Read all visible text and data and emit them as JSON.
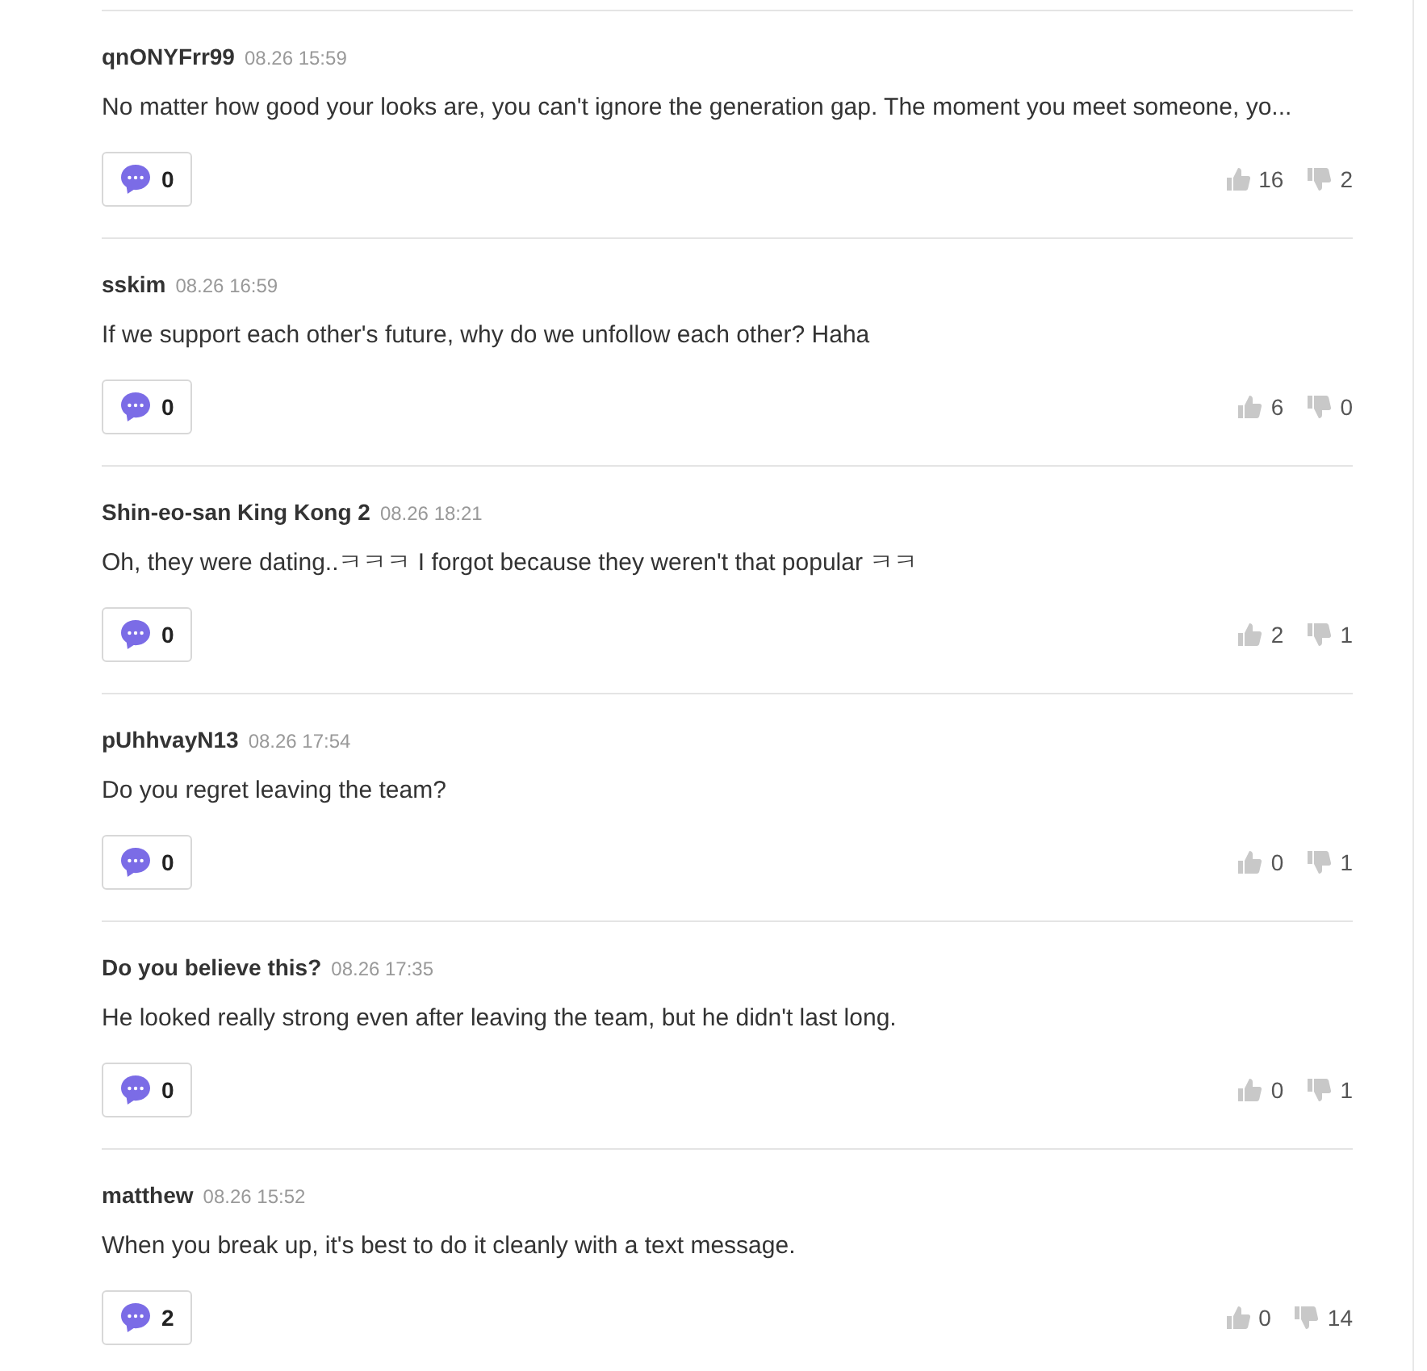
{
  "comments": [
    {
      "user": "qnONYFrr99",
      "time": "08.26 15:59",
      "text": "No matter how good your looks are, you can't ignore the generation gap. The moment you meet someone, yo...",
      "replies": "0",
      "likes": "16",
      "dislikes": "2"
    },
    {
      "user": "sskim",
      "time": "08.26 16:59",
      "text": "If we support each other's future, why do we unfollow each other? Haha",
      "replies": "0",
      "likes": "6",
      "dislikes": "0"
    },
    {
      "user": "Shin-eo-san King Kong 2",
      "time": "08.26 18:21",
      "text": "Oh, they were dating..ㅋㅋㅋ I forgot because they weren't that popular ㅋㅋ",
      "replies": "0",
      "likes": "2",
      "dislikes": "1"
    },
    {
      "user": "pUhhvayN13",
      "time": "08.26 17:54",
      "text": "Do you regret leaving the team?",
      "replies": "0",
      "likes": "0",
      "dislikes": "1"
    },
    {
      "user": "Do you believe this?",
      "time": "08.26 17:35",
      "text": "He looked really strong even after leaving the team, but he didn't last long.",
      "replies": "0",
      "likes": "0",
      "dislikes": "1"
    },
    {
      "user": "matthew",
      "time": "08.26 15:52",
      "text": "When you break up, it's best to do it cleanly with a text message.",
      "replies": "2",
      "likes": "0",
      "dislikes": "14"
    }
  ]
}
